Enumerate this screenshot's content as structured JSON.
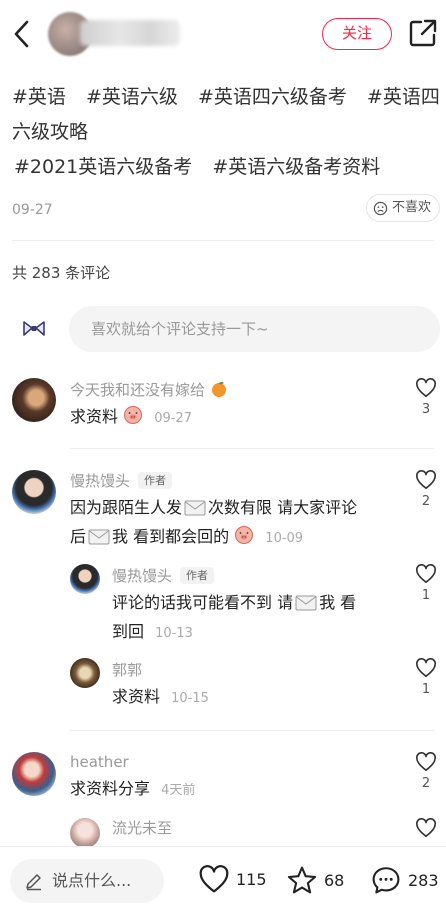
{
  "header": {
    "follow_label": "关注"
  },
  "post": {
    "tags": [
      "#英语",
      "#英语六级",
      "#英语四六级备考",
      "#英语四六级攻略",
      "#2021英语六级备考",
      "#英语六级备考资料"
    ],
    "date": "09-27",
    "dislike_label": "不喜欢"
  },
  "comments_section": {
    "count_label": "共 283 条评论",
    "input_placeholder": "喜欢就给个评论支持一下~"
  },
  "comments": [
    {
      "name": "今天我和还没有嫁给",
      "text": "求资料",
      "time": "09-27",
      "likes": "3"
    },
    {
      "name": "慢热馒头",
      "badge": "作者",
      "text_a": "因为跟陌生人发",
      "text_b": "次数有限 请大家评论",
      "text_c": "后",
      "text_d": "我 看到都会回的",
      "time": "10-09",
      "likes": "2"
    },
    {
      "name": "慢热馒头",
      "badge": "作者",
      "text_a": "评论的话我可能看不到 请",
      "text_b": "我 看",
      "text_c": "到回",
      "time": "10-13",
      "likes": "1"
    },
    {
      "name": "郭郭",
      "text": "求资料",
      "time": "10-15",
      "likes": "1"
    },
    {
      "name": "heather",
      "text": "求资料分享",
      "time": "4天前",
      "likes": "2"
    },
    {
      "name": "流光未至"
    }
  ],
  "bottom_bar": {
    "say_placeholder": "说点什么...",
    "likes": "115",
    "stars": "68",
    "comments": "283"
  },
  "colors": {
    "accent": "#ff2442"
  }
}
